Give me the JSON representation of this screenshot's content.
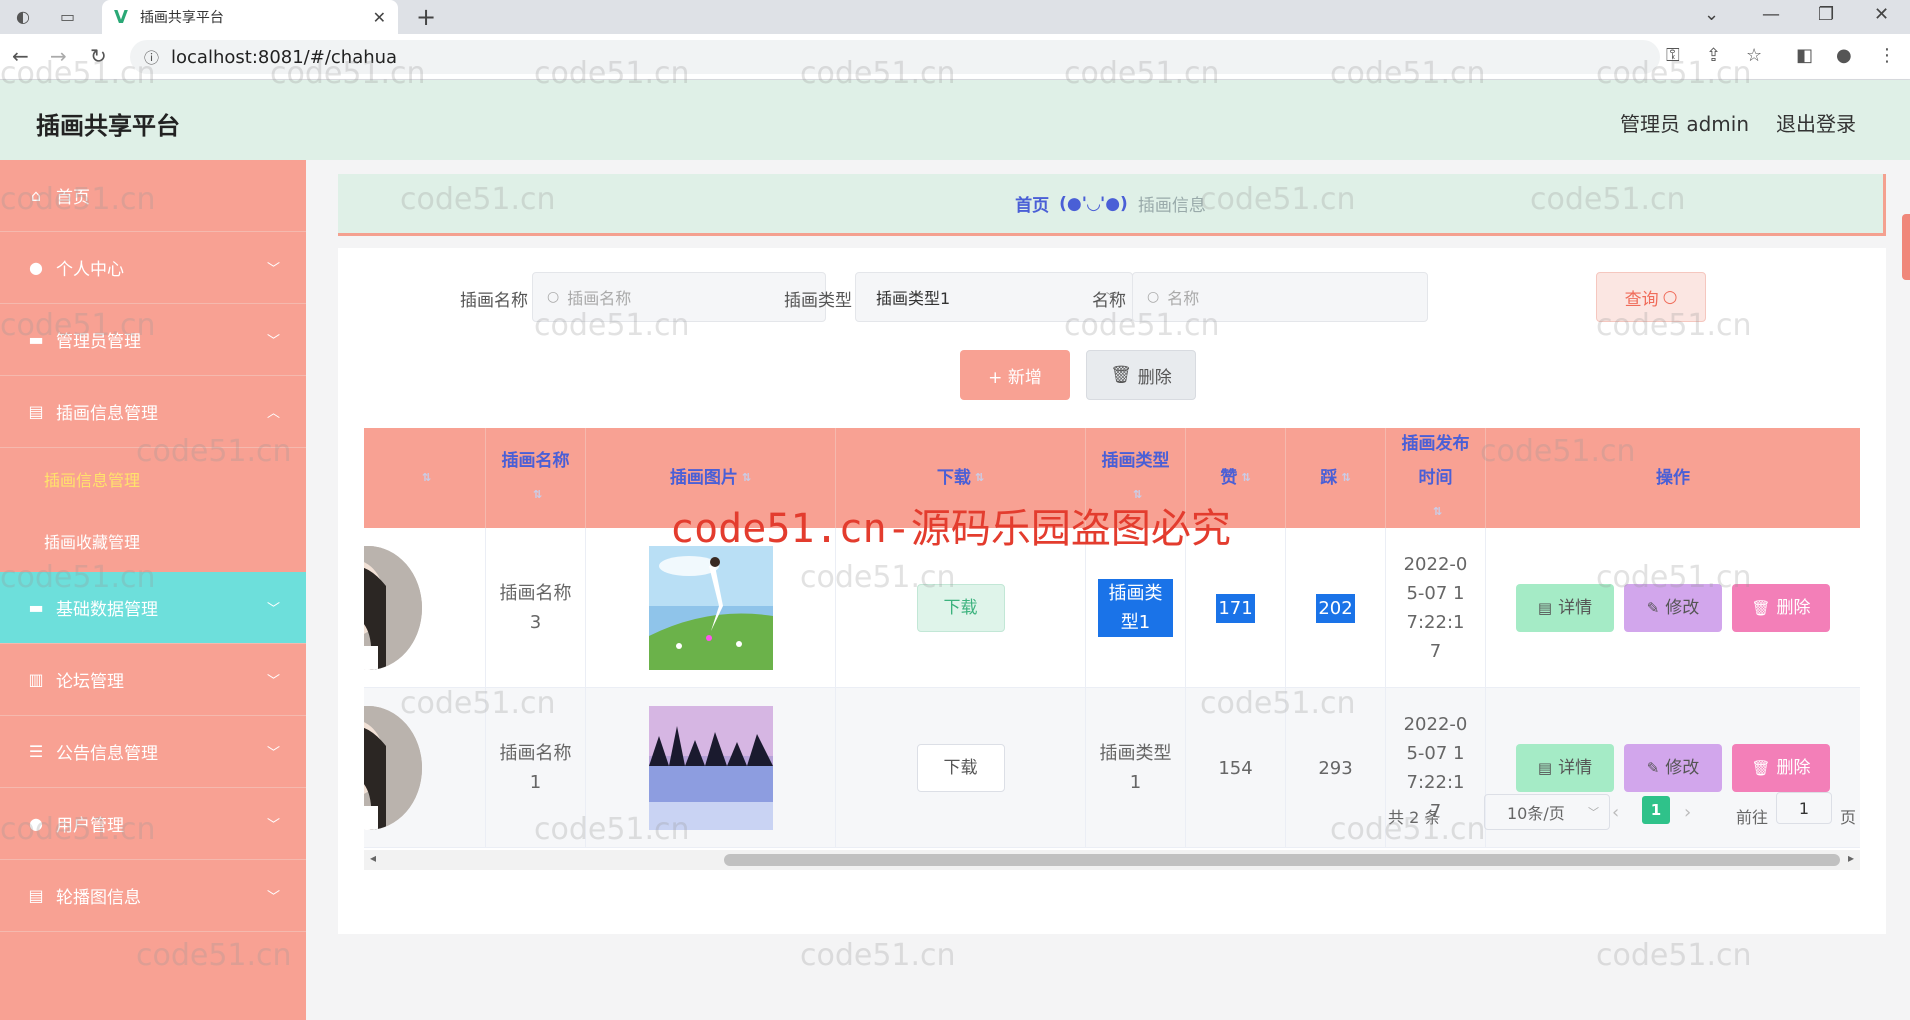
{
  "browser": {
    "tab_title": "插画共享平台",
    "url": "localhost:8081/#/chahua"
  },
  "header": {
    "title": "插画共享平台",
    "admin": "管理员 admin",
    "logout": "退出登录"
  },
  "sidebar": {
    "items": [
      {
        "label": "首页",
        "icon": "home-icon"
      },
      {
        "label": "个人中心",
        "icon": "user-icon"
      },
      {
        "label": "管理员管理",
        "icon": "folder-icon"
      },
      {
        "label": "插画信息管理",
        "icon": "clipboard-icon"
      },
      {
        "label": "基础数据管理",
        "icon": "box-icon"
      },
      {
        "label": "论坛管理",
        "icon": "bar-chart-icon"
      },
      {
        "label": "公告信息管理",
        "icon": "list-icon"
      },
      {
        "label": "用户管理",
        "icon": "user-icon"
      },
      {
        "label": "轮播图信息",
        "icon": "clipboard-icon"
      }
    ],
    "subitems": [
      "插画信息管理",
      "插画收藏管理"
    ]
  },
  "breadcrumb": {
    "home": "首页",
    "face": "(●'◡'●)",
    "current": "插画信息"
  },
  "search": {
    "name_label": "插画名称",
    "name_placeholder": "插画名称",
    "type_label": "插画类型",
    "type_value": "插画类型1",
    "title_label": "名称",
    "title_placeholder": "名称",
    "query": "查询"
  },
  "actions": {
    "add": "+ 新增",
    "delete": "删除"
  },
  "table": {
    "headers": [
      "插画名称",
      "插画图片",
      "下载",
      "插画类型",
      "赞",
      "踩",
      "插画发布时间",
      "操作"
    ],
    "rows": [
      {
        "name": "插画名称3",
        "download": "下载",
        "type": "插画类型1",
        "likes": "171",
        "dislikes": "202",
        "time": "2022-05-07 17:22:17"
      },
      {
        "name": "插画名称1",
        "download": "下载",
        "type": "插画类型1",
        "likes": "154",
        "dislikes": "293",
        "time": "2022-05-07 17:22:17"
      }
    ],
    "op_detail": "详情",
    "op_edit": "修改",
    "op_delete": "删除"
  },
  "pagination": {
    "total": "共 2 条",
    "page_size": "10条/页",
    "current": "1",
    "goto": "前往",
    "goto_value": "1",
    "page_unit": "页"
  },
  "watermark": "code51.cn",
  "banner": "code51.cn-源码乐园盗图必究",
  "colors": {
    "sidebar": "#f8a193",
    "active_menu": "#6ddfdb",
    "header": "#dff0e7",
    "accent_blue": "#4a5fd6"
  }
}
